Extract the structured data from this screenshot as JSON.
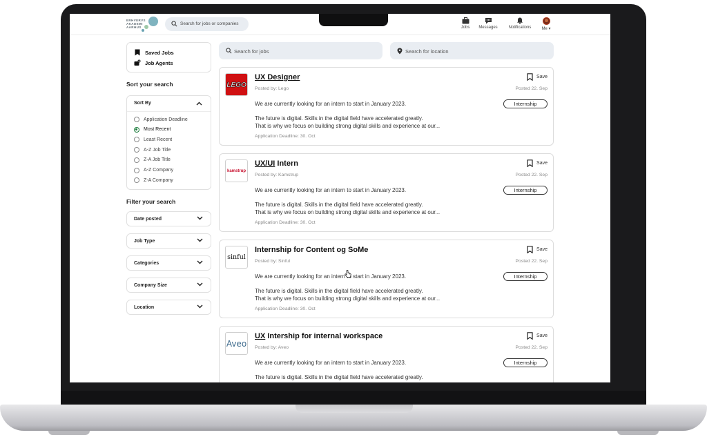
{
  "topnav": {
    "logo_lines": [
      "ERHVERVS",
      "AKADEMI",
      "AARHUS"
    ],
    "search_placeholder": "Search for jobs or companies",
    "items": [
      {
        "label": "Jobs",
        "icon": "briefcase-icon"
      },
      {
        "label": "Messages",
        "icon": "chat-icon"
      },
      {
        "label": "Notifications",
        "icon": "bell-icon"
      },
      {
        "label": "Me ▾",
        "icon": "avatar"
      }
    ]
  },
  "sidebar": {
    "saved_jobs": "Saved Jobs",
    "job_agents": "Job Agents",
    "sort_title": "Sort your search",
    "sort_by": "Sort By",
    "sort_options": [
      {
        "label": "Application Deadline",
        "selected": false
      },
      {
        "label": "Most Recent",
        "selected": true
      },
      {
        "label": "Least Recent",
        "selected": false
      },
      {
        "label": "A-Z Job Title",
        "selected": false
      },
      {
        "label": "Z-A Job Title",
        "selected": false
      },
      {
        "label": "A-Z Company",
        "selected": false
      },
      {
        "label": "Z-A Company",
        "selected": false
      }
    ],
    "filter_title": "Filter your search",
    "filters": [
      "Date posted",
      "Job Type",
      "Categories",
      "Company Size",
      "Location"
    ]
  },
  "search": {
    "jobs_placeholder": "Search for jobs",
    "location_placeholder": "Search for location"
  },
  "jobs": [
    {
      "title_underlined": "UX Designer",
      "title_rest": "",
      "company_logo": "LEGO",
      "posted_by": "Posted by: Lego",
      "posted_date": "Posted 22. Sep",
      "save": "Save",
      "badge": "Internship",
      "desc1": "We are currently looking for an intern to start in January 2023.",
      "desc2": "The future is digital. Skills in the digital field have accelerated greatly.",
      "desc3": "That is why we focus on building strong digital skills and experience at our...",
      "deadline": "Application Deadline: 30. Oct"
    },
    {
      "title_underlined": "UX/UI",
      "title_rest": " Intern",
      "company_logo": "kamstrup",
      "posted_by": "Posted by: Kamstrup",
      "posted_date": "Posted 22. Sep",
      "save": "Save",
      "badge": "Internship",
      "desc1": "We are currently looking for an intern to start in January 2023.",
      "desc2": "The future is digital. Skills in the digital field have accelerated greatly.",
      "desc3": "That is why we focus on building strong digital skills and experience at our...",
      "deadline": "Application Deadline: 30. Oct"
    },
    {
      "title_underlined": "",
      "title_rest": "Internship for Content og SoMe",
      "company_logo": "sinful",
      "posted_by": "Posted by: Sinful",
      "posted_date": "Posted 22. Sep",
      "save": "Save",
      "badge": "Internship",
      "desc1": "We are currently looking for an intern to start in January 2023.",
      "desc2": "The future is digital. Skills in the digital field have accelerated greatly.",
      "desc3": "That is why we focus on building strong digital skills and experience at our...",
      "deadline": "Application Deadline: 30. Oct"
    },
    {
      "title_underlined": "UX",
      "title_rest": " Intership for internal workspace",
      "company_logo": "Aveo",
      "posted_by": "Posted by: Aveo",
      "posted_date": "Posted 22. Sep",
      "save": "Save",
      "badge": "Internship",
      "desc1": "We are currently looking for an intern to start in January 2023.",
      "desc2": "The future is digital. Skills in the digital field have accelerated greatly.",
      "desc3": "",
      "deadline": ""
    }
  ],
  "colors": {
    "accent_green": "#1a7a3a",
    "search_bg": "#e9edf2",
    "lego_red": "#d01012",
    "kamstrup_red": "#c8102e"
  }
}
